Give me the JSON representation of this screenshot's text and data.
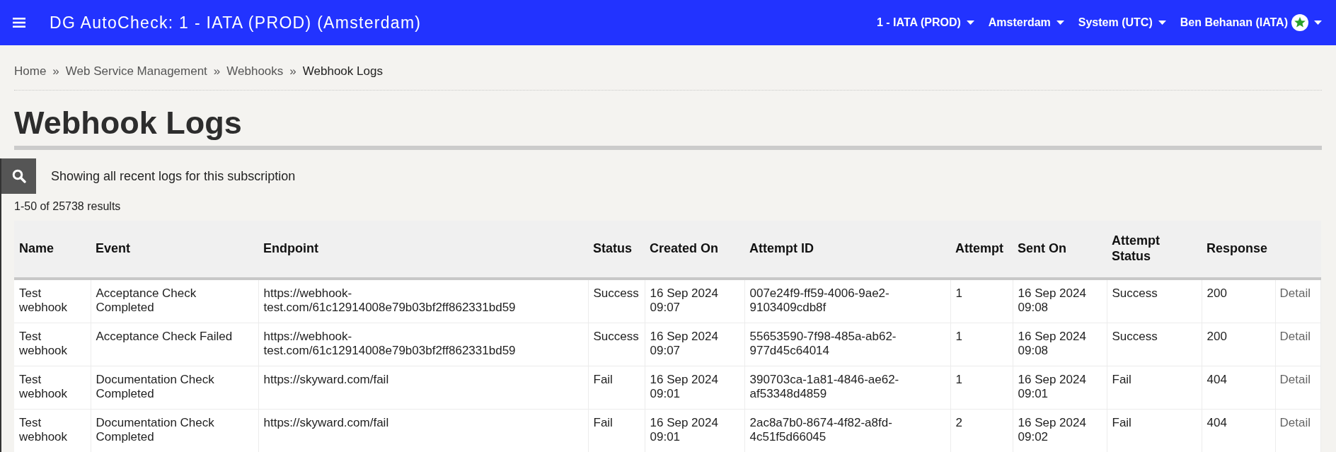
{
  "header": {
    "title": "DG AutoCheck: 1 - IATA (PROD) (Amsterdam)",
    "menus": [
      {
        "label": "1 - IATA (PROD)",
        "kind": "dropdown"
      },
      {
        "label": "Amsterdam",
        "kind": "dropdown"
      },
      {
        "label": "System (UTC)",
        "kind": "dropdown"
      },
      {
        "label": "Ben Behanan (IATA)",
        "kind": "user"
      }
    ]
  },
  "breadcrumb": [
    {
      "label": "Home",
      "current": false
    },
    {
      "label": "Web Service Management",
      "current": false
    },
    {
      "label": "Webhooks",
      "current": false
    },
    {
      "label": "Webhook Logs",
      "current": true
    }
  ],
  "breadcrumb_separator": "»",
  "page_title": "Webhook Logs",
  "filter_summary": "Showing all recent logs for this subscription",
  "results_count": "1-50 of 25738 results",
  "table": {
    "columns": [
      "Name",
      "Event",
      "Endpoint",
      "Status",
      "Created On",
      "Attempt ID",
      "Attempt",
      "Sent On",
      "Attempt Status",
      "Response"
    ],
    "rows": [
      {
        "cells": [
          "Test webhook",
          "Acceptance Check Completed",
          "https://webhook-test.com/61c12914008e79b03bf2ff862331bd59",
          "Success",
          "16 Sep 2024 09:07",
          "007e24f9-ff59-4006-9ae2-9103409cdb8f",
          "1",
          "16 Sep 2024 09:08",
          "Success",
          "200"
        ],
        "action": "Detail"
      },
      {
        "cells": [
          "Test webhook",
          "Acceptance Check Failed",
          "https://webhook-test.com/61c12914008e79b03bf2ff862331bd59",
          "Success",
          "16 Sep 2024 09:07",
          "55653590-7f98-485a-ab62-977d45c64014",
          "1",
          "16 Sep 2024 09:08",
          "Success",
          "200"
        ],
        "action": "Detail"
      },
      {
        "cells": [
          "Test webhook",
          "Documentation Check Completed",
          "https://skyward.com/fail",
          "Fail",
          "16 Sep 2024 09:01",
          "390703ca-1a81-4846-ae62-af53348d4859",
          "1",
          "16 Sep 2024 09:01",
          "Fail",
          "404"
        ],
        "action": "Detail"
      },
      {
        "cells": [
          "Test webhook",
          "Documentation Check Completed",
          "https://skyward.com/fail",
          "Fail",
          "16 Sep 2024 09:01",
          "2ac8a7b0-8674-4f82-a8fd-4c51f5d66045",
          "2",
          "16 Sep 2024 09:02",
          "Fail",
          "404"
        ],
        "action": "Detail"
      }
    ]
  }
}
